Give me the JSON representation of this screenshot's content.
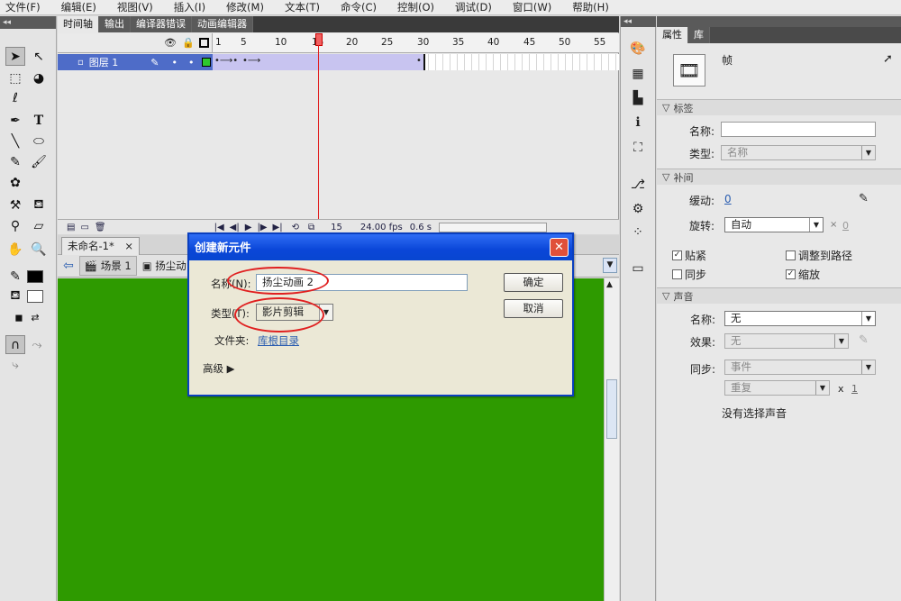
{
  "menu": [
    "文件(F)",
    "编辑(E)",
    "视图(V)",
    "插入(I)",
    "修改(M)",
    "文本(T)",
    "命令(C)",
    "控制(O)",
    "调试(D)",
    "窗口(W)",
    "帮助(H)"
  ],
  "timeline": {
    "tabs": [
      "时间轴",
      "输出",
      "编译器错误",
      "动画编辑器"
    ],
    "ruler": [
      "1",
      "5",
      "10",
      "15",
      "20",
      "25",
      "30",
      "35",
      "40",
      "45",
      "50",
      "55"
    ],
    "layer_name": "图层 1",
    "current_frame": "15",
    "fps": "24.00 fps",
    "time": "0.6 s"
  },
  "stage": {
    "doc_tab": "未命名-1*",
    "close": "×",
    "scene": "场景 1",
    "symbol": "扬尘动"
  },
  "dialog": {
    "title": "创建新元件",
    "close": "✕",
    "name_label": "名称(N):",
    "name_value": "扬尘动画 2",
    "type_label": "类型(T):",
    "type_value": "影片剪辑",
    "folder_label": "文件夹:",
    "folder_value": "库根目录",
    "advanced": "高级 ▶",
    "ok": "确定",
    "cancel": "取消"
  },
  "props": {
    "tabs": [
      "属性",
      "库"
    ],
    "frame_label": "帧",
    "sec_label": "标签",
    "name_label": "名称:",
    "type_label": "类型:",
    "type_value": "名称",
    "sec_tween": "补间",
    "ease_label": "缓动:",
    "ease_value": "0",
    "rotate_label": "旋转:",
    "rotate_value": "自动",
    "rotate_x": "×",
    "rotate_count": "0",
    "snap": "贴紧",
    "orient": "调整到路径",
    "sync": "同步",
    "scale": "缩放",
    "sec_sound": "声音",
    "sound_name_label": "名称:",
    "sound_name_value": "无",
    "effect_label": "效果:",
    "effect_value": "无",
    "sync_label": "同步:",
    "sync_value": "事件",
    "repeat_value": "重复",
    "repeat_x": "x",
    "repeat_count": "1",
    "no_sound": "没有选择声音"
  },
  "colors": {
    "stage": "#2e9a00",
    "dialog_title": "#0a46d8",
    "highlight": "#e02020"
  }
}
